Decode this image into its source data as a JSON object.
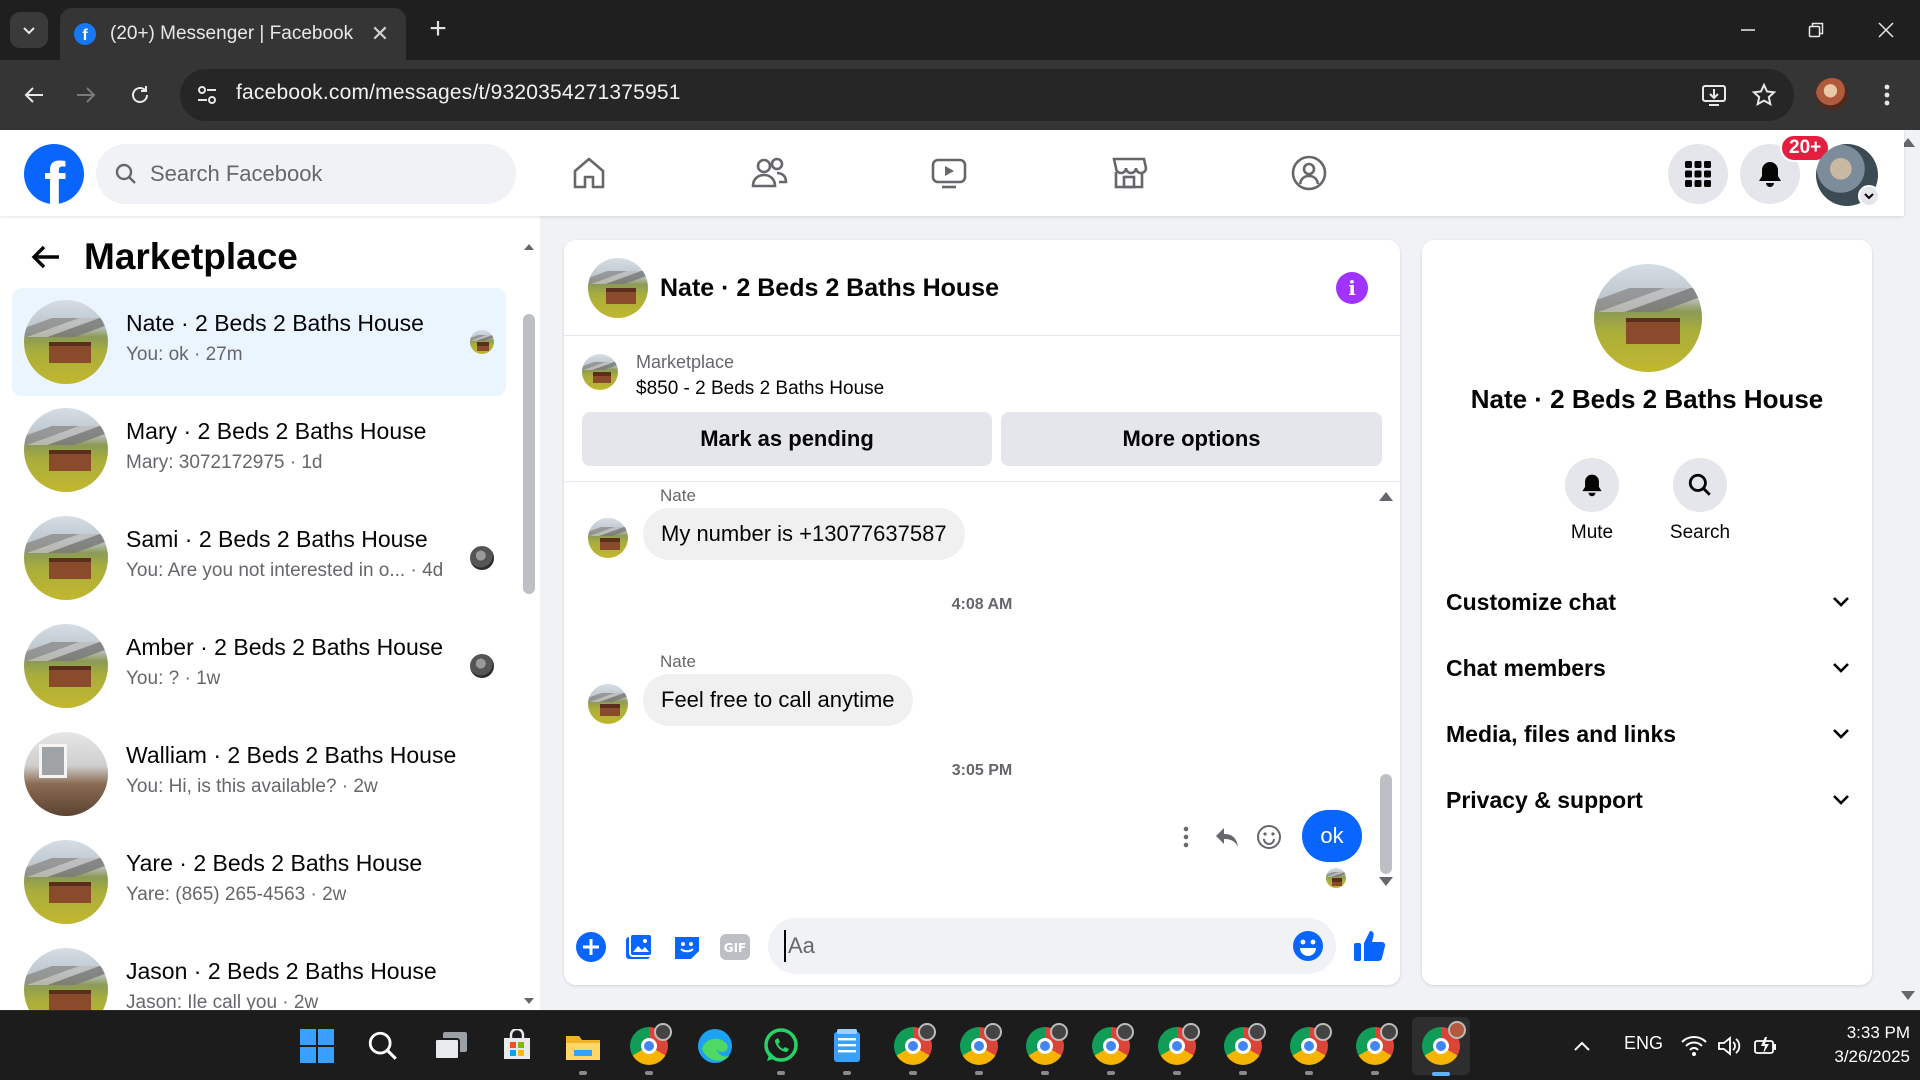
{
  "browser": {
    "tab_title": "(20+) Messenger | Facebook",
    "url": "facebook.com/messages/t/9320354271375951"
  },
  "header": {
    "search_placeholder": "Search Facebook",
    "notifications_badge": "20+"
  },
  "left": {
    "title": "Marketplace",
    "conversations": [
      {
        "name": "Nate · 2 Beds 2 Baths House",
        "snippet": "You: ok · 27m",
        "avatar": "house-field",
        "active": true
      },
      {
        "name": "Mary · 2 Beds 2 Baths House",
        "snippet": "Mary: 3072172975 · 1d",
        "avatar": "house-field"
      },
      {
        "name": "Sami · 2 Beds 2 Baths House",
        "snippet": "You: Are you not interested in o... · 4d",
        "avatar": "house-field"
      },
      {
        "name": "Amber · 2 Beds 2 Baths House",
        "snippet": "You: ? · 1w",
        "avatar": "house-field"
      },
      {
        "name": "Walliam · 2 Beds 2 Baths House",
        "snippet": "You: Hi, is this available? · 2w",
        "avatar": "room-interior"
      },
      {
        "name": "Yare · 2 Beds 2 Baths House",
        "snippet": "Yare: (865) 265-4563 · 2w",
        "avatar": "house-field"
      },
      {
        "name": "Jason · 2 Beds 2 Baths House",
        "snippet": "Jason: Ile call you · 2w",
        "avatar": "house-field"
      }
    ]
  },
  "chat": {
    "title": "Nate · 2 Beds 2 Baths House",
    "listing": {
      "label": "Marketplace",
      "title": "$850 - 2 Beds 2 Baths House",
      "mark_pending": "Mark as pending",
      "more_options": "More options"
    },
    "messages": {
      "sender1": "Nate",
      "msg1": "My number is +13077637587",
      "time1": "4:08 AM",
      "sender2": "Nate",
      "msg2": "Feel free to call anytime",
      "time2": "3:05 PM",
      "outgoing": "ok"
    },
    "composer_placeholder": "Aa"
  },
  "right": {
    "name": "Nate · 2 Beds 2 Baths House",
    "mute_label": "Mute",
    "search_label": "Search",
    "sections": [
      "Customize chat",
      "Chat members",
      "Media, files and links",
      "Privacy & support"
    ]
  },
  "taskbar": {
    "language": "ENG",
    "time": "3:33 PM",
    "date": "3/26/2025"
  },
  "colors": {
    "fb_blue": "#0866ff",
    "badge_red": "#e41e3f",
    "info_purple": "#a033ff",
    "active_row": "#ebf5ff"
  }
}
